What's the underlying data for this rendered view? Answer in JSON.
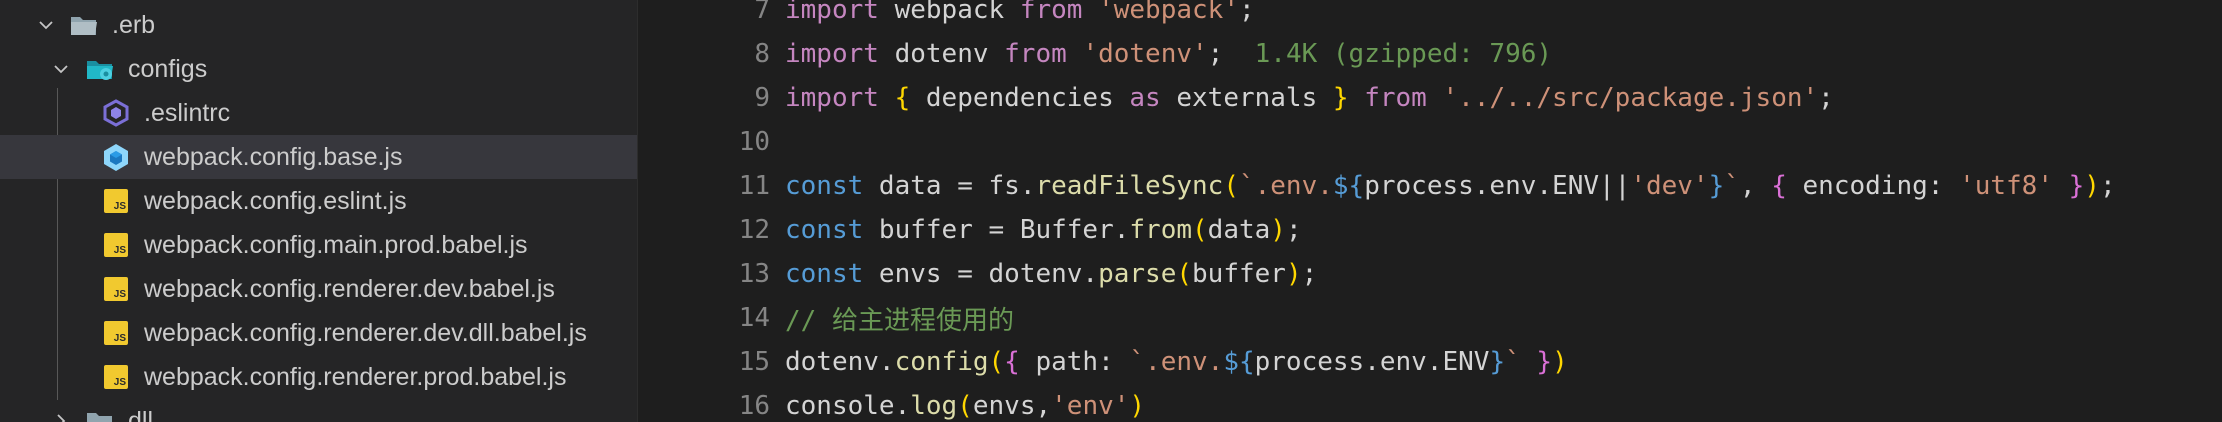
{
  "explorer": {
    "items": [
      {
        "label": ".erb",
        "kind": "folder",
        "expanded": true
      },
      {
        "label": "configs",
        "kind": "folder-config",
        "expanded": true
      },
      {
        "label": ".eslintrc",
        "kind": "eslint-file"
      },
      {
        "label": "webpack.config.base.js",
        "kind": "webpack-file",
        "selected": true
      },
      {
        "label": "webpack.config.eslint.js",
        "kind": "js-file"
      },
      {
        "label": "webpack.config.main.prod.babel.js",
        "kind": "js-file"
      },
      {
        "label": "webpack.config.renderer.dev.babel.js",
        "kind": "js-file"
      },
      {
        "label": "webpack.config.renderer.dev.dll.babel.js",
        "kind": "js-file"
      },
      {
        "label": "webpack.config.renderer.prod.babel.js",
        "kind": "js-file"
      },
      {
        "label": "dll",
        "kind": "folder",
        "expanded": false
      }
    ]
  },
  "editor": {
    "lines": [
      {
        "number": "7",
        "tokens": [
          {
            "t": "import",
            "c": "kw2"
          },
          {
            "t": " webpack ",
            "c": "var"
          },
          {
            "t": "from",
            "c": "kw2"
          },
          {
            "t": " ",
            "c": "var"
          },
          {
            "t": "'webpack'",
            "c": "str"
          },
          {
            "t": ";",
            "c": "var"
          }
        ]
      },
      {
        "number": "8",
        "tokens": [
          {
            "t": "import",
            "c": "kw2"
          },
          {
            "t": " dotenv ",
            "c": "var"
          },
          {
            "t": "from",
            "c": "kw2"
          },
          {
            "t": " ",
            "c": "var"
          },
          {
            "t": "'dotenv'",
            "c": "str"
          },
          {
            "t": ";",
            "c": "var"
          },
          {
            "t": "  1.4K (gzipped: 796)",
            "c": "lens"
          }
        ]
      },
      {
        "number": "9",
        "tokens": [
          {
            "t": "import",
            "c": "kw2"
          },
          {
            "t": " ",
            "c": "var"
          },
          {
            "t": "{",
            "c": "br1"
          },
          {
            "t": " dependencies ",
            "c": "var"
          },
          {
            "t": "as",
            "c": "kw2"
          },
          {
            "t": " externals ",
            "c": "var"
          },
          {
            "t": "}",
            "c": "br1"
          },
          {
            "t": " ",
            "c": "var"
          },
          {
            "t": "from",
            "c": "kw2"
          },
          {
            "t": " ",
            "c": "var"
          },
          {
            "t": "'../../src/package.json'",
            "c": "str"
          },
          {
            "t": ";",
            "c": "var"
          }
        ]
      },
      {
        "number": "10",
        "tokens": []
      },
      {
        "number": "11",
        "tokens": [
          {
            "t": "const",
            "c": "kw"
          },
          {
            "t": " data = fs.",
            "c": "var"
          },
          {
            "t": "readFileSync",
            "c": "fn"
          },
          {
            "t": "(",
            "c": "br1"
          },
          {
            "t": "`.env.",
            "c": "tpl"
          },
          {
            "t": "${",
            "c": "kw"
          },
          {
            "t": "process.env.ENV||",
            "c": "var"
          },
          {
            "t": "'dev'",
            "c": "str"
          },
          {
            "t": "}",
            "c": "kw"
          },
          {
            "t": "`",
            "c": "tpl"
          },
          {
            "t": ", ",
            "c": "var"
          },
          {
            "t": "{",
            "c": "br2"
          },
          {
            "t": " encoding: ",
            "c": "var"
          },
          {
            "t": "'utf8'",
            "c": "str"
          },
          {
            "t": " ",
            "c": "var"
          },
          {
            "t": "}",
            "c": "br2"
          },
          {
            "t": ")",
            "c": "br1"
          },
          {
            "t": ";",
            "c": "var"
          }
        ]
      },
      {
        "number": "12",
        "tokens": [
          {
            "t": "const",
            "c": "kw"
          },
          {
            "t": " buffer = Buffer.",
            "c": "var"
          },
          {
            "t": "from",
            "c": "fn"
          },
          {
            "t": "(",
            "c": "br1"
          },
          {
            "t": "data",
            "c": "var"
          },
          {
            "t": ")",
            "c": "br1"
          },
          {
            "t": ";",
            "c": "var"
          }
        ]
      },
      {
        "number": "13",
        "tokens": [
          {
            "t": "const",
            "c": "kw"
          },
          {
            "t": " envs = dotenv.",
            "c": "var"
          },
          {
            "t": "parse",
            "c": "fn"
          },
          {
            "t": "(",
            "c": "br1"
          },
          {
            "t": "buffer",
            "c": "var"
          },
          {
            "t": ")",
            "c": "br1"
          },
          {
            "t": ";",
            "c": "var"
          }
        ]
      },
      {
        "number": "14",
        "tokens": [
          {
            "t": "// 给主进程使用的",
            "c": "cmt"
          }
        ]
      },
      {
        "number": "15",
        "tokens": [
          {
            "t": "dotenv.",
            "c": "var"
          },
          {
            "t": "config",
            "c": "fn"
          },
          {
            "t": "(",
            "c": "br1"
          },
          {
            "t": "{",
            "c": "br2"
          },
          {
            "t": " path: ",
            "c": "var"
          },
          {
            "t": "`.env.",
            "c": "tpl"
          },
          {
            "t": "${",
            "c": "kw"
          },
          {
            "t": "process.env.ENV",
            "c": "var"
          },
          {
            "t": "}",
            "c": "kw"
          },
          {
            "t": "`",
            "c": "tpl"
          },
          {
            "t": " ",
            "c": "var"
          },
          {
            "t": "}",
            "c": "br2"
          },
          {
            "t": ")",
            "c": "br1"
          }
        ]
      },
      {
        "number": "16",
        "tokens": [
          {
            "t": "console.",
            "c": "var"
          },
          {
            "t": "log",
            "c": "fn"
          },
          {
            "t": "(",
            "c": "br1"
          },
          {
            "t": "envs,",
            "c": "var"
          },
          {
            "t": "'env'",
            "c": "str"
          },
          {
            "t": ")",
            "c": "br1"
          }
        ]
      }
    ]
  },
  "colors": {
    "sidebar_bg": "#252526",
    "editor_bg": "#1e1e1e",
    "selection_bg": "#37373d",
    "js_badge": "#f1c92f",
    "webpack_icon": "#8ed6fb",
    "folder_config_icon": "#21b8c7"
  }
}
